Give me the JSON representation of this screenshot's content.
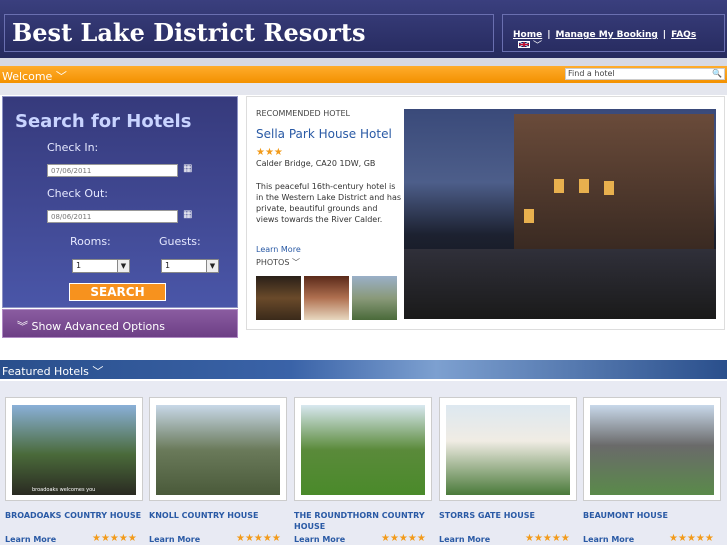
{
  "header": {
    "title": "Best Lake District Resorts",
    "nav": [
      {
        "label": "Home"
      },
      {
        "label": "Manage My Booking"
      },
      {
        "label": "FAQs"
      }
    ],
    "separator": "|"
  },
  "welcome": {
    "label": "Welcome ﹀",
    "search_placeholder": "Find a hotel"
  },
  "search_panel": {
    "title": "Search for Hotels",
    "checkin_label": "Check In:",
    "checkin_value": "07/06/2011",
    "checkout_label": "Check Out:",
    "checkout_value": "08/06/2011",
    "rooms_label": "Rooms:",
    "guests_label": "Guests:",
    "rooms_value": "1",
    "guests_value": "1",
    "search_button": "SEARCH",
    "advanced": "︾ Show Advanced Options"
  },
  "recommended": {
    "label": "RECOMMENDED HOTEL",
    "name": "Sella Park House Hotel",
    "stars": "★★★",
    "address": "Calder Bridge, CA20 1DW, GB",
    "description": "This peaceful 16th-century hotel is in the Western Lake District and has private, beautiful grounds and views towards the River Calder.",
    "learn_more": "Learn More",
    "photos": "PHOTOS ﹀"
  },
  "featured": {
    "label": "Featured Hotels ﹀",
    "hotels": [
      {
        "name": "BROADOAKS COUNTRY HOUSE",
        "learn_more": "Learn More",
        "stars": "★★★★★",
        "caption": "broadoaks welcomes you"
      },
      {
        "name": "KNOLL COUNTRY HOUSE",
        "learn_more": "Learn More",
        "stars": "★★★★★"
      },
      {
        "name": "THE ROUNDTHORN COUNTRY HOUSE",
        "learn_more": "Learn More",
        "stars": "★★★★★"
      },
      {
        "name": "STORRS GATE HOUSE",
        "learn_more": "Learn More",
        "stars": "★★★★★"
      },
      {
        "name": "BEAUMONT HOUSE",
        "learn_more": "Learn More",
        "stars": "★★★★★"
      }
    ]
  },
  "colors": {
    "header_bg": "#262a5e",
    "welcome_bar": "#f39100",
    "search_button": "#f7921e",
    "link_blue": "#2a5aa5",
    "star_orange": "#f29b1b"
  },
  "icons": [
    "calendar-icon",
    "search-icon",
    "flag-icon",
    "chevron-down-icon"
  ]
}
